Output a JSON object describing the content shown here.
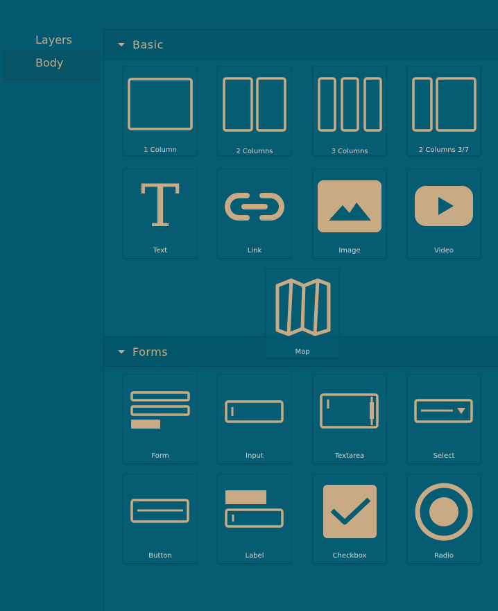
{
  "layers": {
    "title": "Layers",
    "items": [
      "Body"
    ]
  },
  "sections": {
    "basic": {
      "title": "Basic"
    },
    "forms": {
      "title": "Forms"
    }
  },
  "blocks": {
    "col1": "1 Column",
    "col2": "2 Columns",
    "col3": "3 Columns",
    "col37": "2 Columns 3/7",
    "text": "Text",
    "link": "Link",
    "image": "Image",
    "video": "Video",
    "map": "Map",
    "form": "Form",
    "input": "Input",
    "textarea": "Textarea",
    "select": "Select",
    "button": "Button",
    "label": "Label",
    "checkbox": "Checkbox",
    "radio": "Radio"
  },
  "colors": {
    "background": "#045870",
    "accent": "#c8ab85",
    "panel": "#055c73"
  }
}
